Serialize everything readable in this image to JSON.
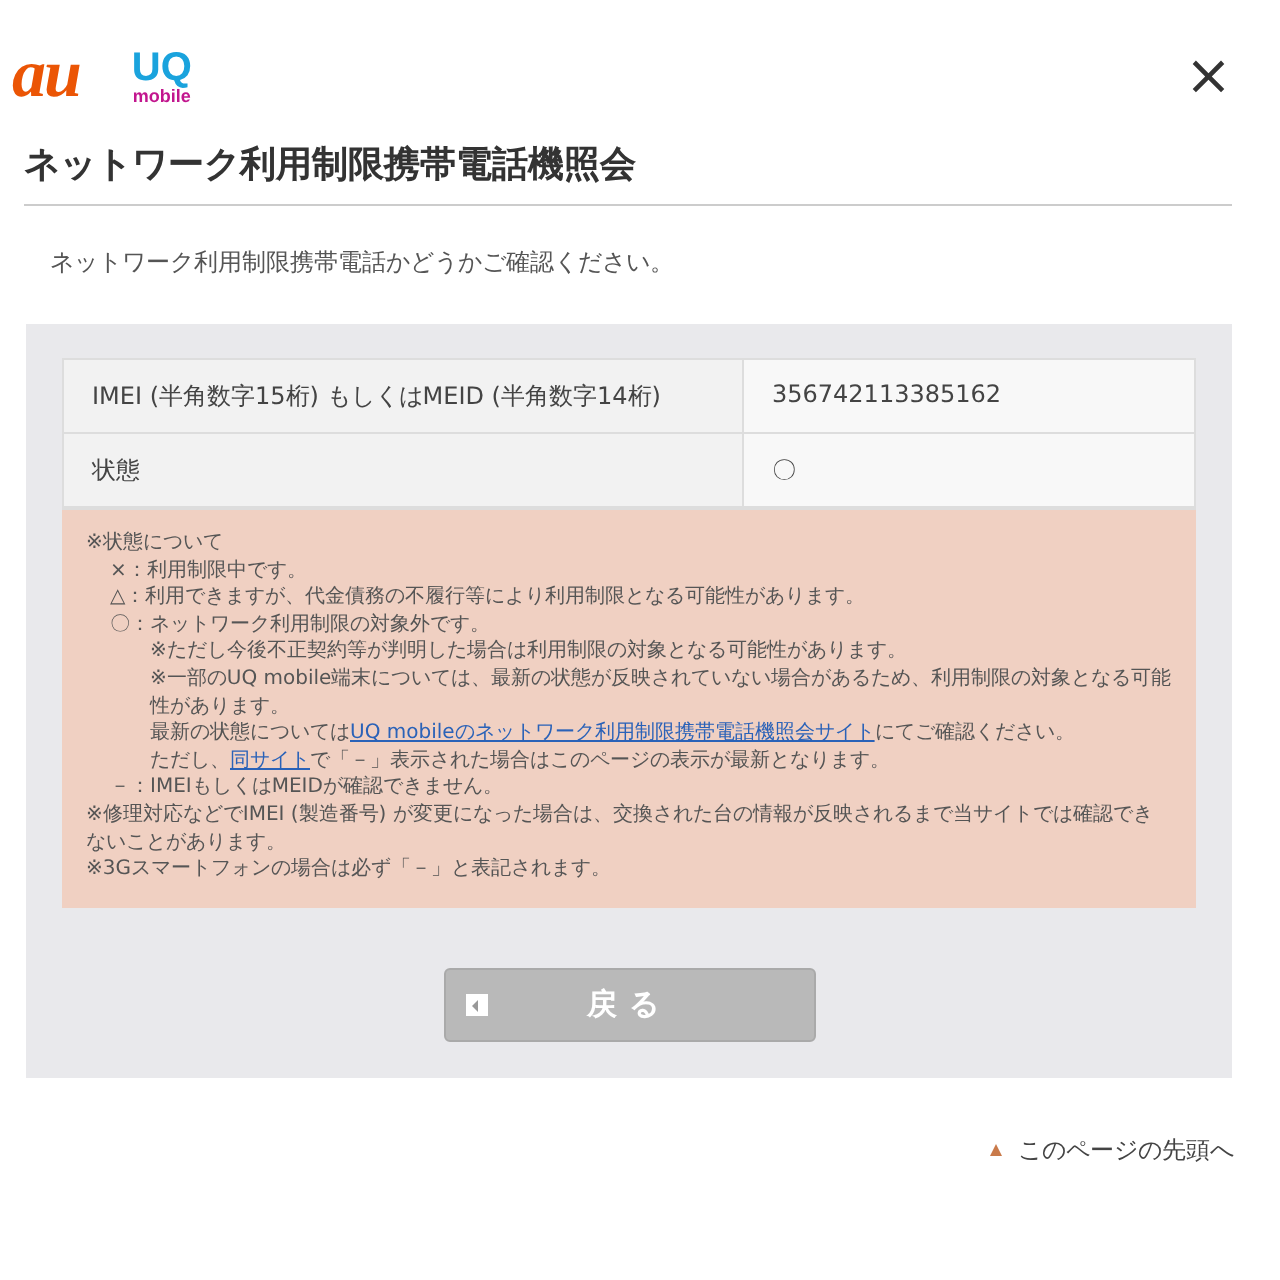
{
  "header": {
    "brand_logos": [
      "au",
      "UQ",
      "mobile"
    ],
    "close": "×"
  },
  "title": "ネットワーク利用制限携帯電話機照会",
  "intro": "ネットワーク利用制限携帯電話かどうかご確認ください。",
  "result_table": {
    "rows": [
      {
        "label": "IMEI (半角数字15桁) もしくはMEID (半角数字14桁)",
        "value": "356742113385162"
      },
      {
        "label": "状態",
        "value": "〇"
      }
    ]
  },
  "notes": [
    {
      "parts": [
        {
          "text": "※状態について"
        }
      ],
      "children": [
        {
          "parts": [
            {
              "text": "×：利用制限中です。"
            }
          ]
        },
        {
          "parts": [
            {
              "text": "△：利用できますが、代金債務の不履行等により利用制限となる可能性があります。"
            }
          ]
        },
        {
          "parts": [
            {
              "text": "〇：ネットワーク利用制限の対象外です。"
            }
          ],
          "children": [
            {
              "parts": [
                {
                  "text": "※ただし今後不正契約等が判明した場合は利用制限の対象となる可能性があります。"
                }
              ]
            },
            {
              "parts": [
                {
                  "text": "※一部のUQ mobile端末については、最新の状態が反映されていない場合があるため、利用制限の対象となる可能性があります。"
                }
              ]
            },
            {
              "parts": [
                {
                  "text": "最新の状態については"
                },
                {
                  "text": "UQ mobileのネットワーク利用制限携帯電話機照会サイト",
                  "link": true
                },
                {
                  "text": "にてご確認ください。"
                }
              ]
            },
            {
              "parts": [
                {
                  "text": "ただし、"
                },
                {
                  "text": "同サイト",
                  "link": true
                },
                {
                  "text": "で「－」表示された場合はこのページの表示が最新となります。"
                }
              ]
            }
          ]
        },
        {
          "parts": [
            {
              "text": "－：IMEIもしくはMEIDが確認できません。"
            }
          ]
        }
      ]
    },
    {
      "parts": [
        {
          "text": "※修理対応などでIMEI (製造番号) が変更になった場合は、交換された台の情報が反映されるまで当サイトでは確認できないことがあります。"
        }
      ]
    },
    {
      "parts": [
        {
          "text": "※3Gスマートフォンの場合は必ず「－」と表記されます。"
        }
      ]
    }
  ],
  "back_button": "戻る",
  "page_top_link": "このページの先頭へ"
}
